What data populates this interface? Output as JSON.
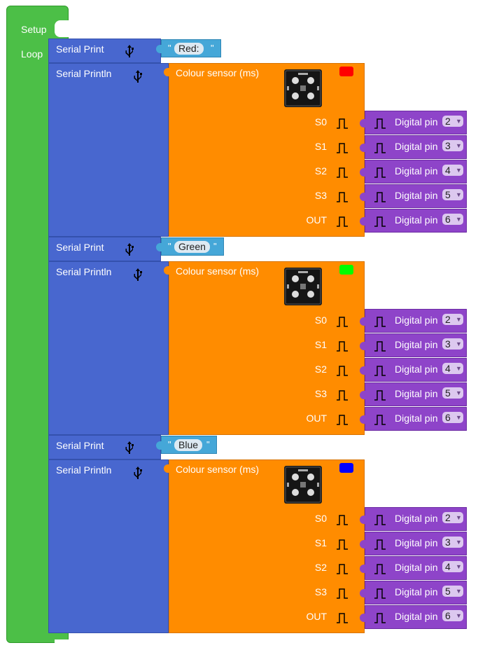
{
  "setup_label": "Setup",
  "loop_label": "Loop",
  "serial_print_label": "Serial Print",
  "serial_println_label": "Serial Println",
  "quote_char": "\"",
  "sensor_title": "Colour sensor (ms)",
  "digital_pin_label": "Digital pin",
  "pins": [
    {
      "label": "S0",
      "value": "2"
    },
    {
      "label": "S1",
      "value": "3"
    },
    {
      "label": "S2",
      "value": "4"
    },
    {
      "label": "S3",
      "value": "5"
    },
    {
      "label": "OUT",
      "value": "6"
    }
  ],
  "groups": [
    {
      "text": "Red:",
      "swatch_color": "#ff0000"
    },
    {
      "text": "Green",
      "swatch_color": "#00ff00"
    },
    {
      "text": "Blue",
      "swatch_color": "#0000ff"
    }
  ],
  "icons": {
    "usb": "usb-icon",
    "pulse": "pulse-icon",
    "module": "color-sensor-module-image",
    "dropdown": "dropdown-arrow-icon"
  },
  "colors": {
    "setup": "#4cbf47",
    "serial": "#4867cf",
    "text": "#45a7d8",
    "sensor": "#ff8c00",
    "pin": "#8e44c9"
  }
}
